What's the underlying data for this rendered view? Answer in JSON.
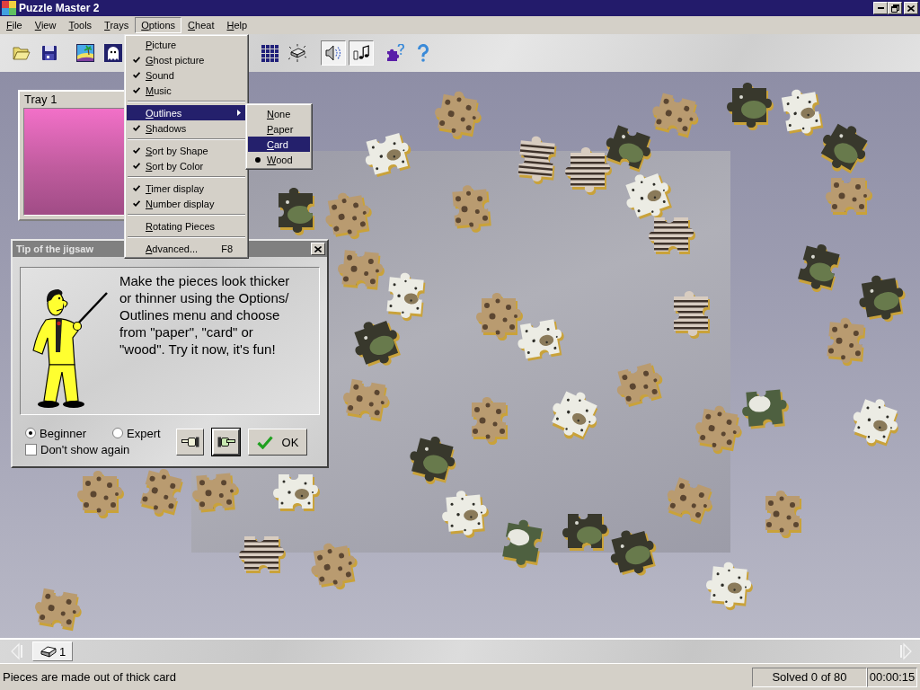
{
  "window": {
    "title": "Puzzle Master 2"
  },
  "menu_bar": [
    {
      "label": "File",
      "selected": false
    },
    {
      "label": "View",
      "selected": false
    },
    {
      "label": "Tools",
      "selected": false
    },
    {
      "label": "Trays",
      "selected": false
    },
    {
      "label": "Options",
      "selected": true
    },
    {
      "label": "Cheat",
      "selected": false
    },
    {
      "label": "Help",
      "selected": false
    }
  ],
  "toolbar": [
    {
      "buttons": [
        {
          "kind": "open",
          "pressed": false
        },
        {
          "kind": "save",
          "pressed": false
        }
      ]
    },
    {
      "buttons": [
        {
          "kind": "picture",
          "pressed": false
        },
        {
          "kind": "ghost",
          "pressed": false
        }
      ]
    },
    {
      "buttons": [
        {
          "kind": "grid",
          "pressed": false
        },
        {
          "kind": "card",
          "pressed": false
        }
      ]
    },
    {
      "buttons": [
        {
          "kind": "sound",
          "pressed": true
        },
        {
          "kind": "music",
          "pressed": true
        }
      ]
    },
    {
      "buttons": [
        {
          "kind": "piece-help",
          "pressed": false
        },
        {
          "kind": "help",
          "pressed": false
        }
      ]
    }
  ],
  "tray": {
    "title": "Tray 1"
  },
  "options_menu": {
    "groups": [
      [
        {
          "label": "Picture",
          "checked": false,
          "selected": false,
          "submenu": false
        },
        {
          "label": "Ghost picture",
          "checked": true,
          "selected": false,
          "submenu": false
        },
        {
          "label": "Sound",
          "checked": true,
          "selected": false,
          "submenu": false
        },
        {
          "label": "Music",
          "checked": true,
          "selected": false,
          "submenu": false
        }
      ],
      [
        {
          "label": "Outlines",
          "checked": false,
          "selected": true,
          "submenu": true
        },
        {
          "label": "Shadows",
          "checked": true,
          "selected": false,
          "submenu": false
        }
      ],
      [
        {
          "label": "Sort by Shape",
          "checked": true,
          "selected": false,
          "submenu": false
        },
        {
          "label": "Sort by Color",
          "checked": true,
          "selected": false,
          "submenu": false
        }
      ],
      [
        {
          "label": "Timer display",
          "checked": true,
          "selected": false,
          "submenu": false
        },
        {
          "label": "Number display",
          "checked": true,
          "selected": false,
          "submenu": false
        }
      ],
      [
        {
          "label": "Rotating Pieces",
          "checked": false,
          "selected": false,
          "submenu": false
        }
      ],
      [
        {
          "label": "Advanced...",
          "shortcut": "F8",
          "checked": false,
          "selected": false,
          "submenu": false
        }
      ]
    ]
  },
  "outlines_submenu": [
    {
      "label": "None",
      "checked": false,
      "selected": false
    },
    {
      "label": "Paper",
      "checked": false,
      "selected": false
    },
    {
      "label": "Card",
      "checked": false,
      "selected": true
    },
    {
      "label": "Wood",
      "checked": true,
      "selected": false
    }
  ],
  "tip_dialog": {
    "title": "Tip of the jigsaw",
    "text_lines": [
      "Make the pieces look thicker",
      "or thinner using the Options/",
      "Outlines menu and choose",
      "from \"paper\", \"card\" or",
      "\"wood\". Try it now, it's fun!"
    ],
    "levels": [
      {
        "label": "Beginner",
        "selected": true
      },
      {
        "label": "Expert",
        "selected": false
      }
    ],
    "dont_show": {
      "label": "Don't show again",
      "checked": false
    },
    "buttons": [
      {
        "kind": "back",
        "default": false
      },
      {
        "kind": "next",
        "default": true
      },
      {
        "kind": "ok",
        "label": "OK",
        "default": false
      }
    ]
  },
  "tray_tabs": [
    {
      "label": "1",
      "selected": true
    }
  ],
  "status_bar": {
    "message": "Pieces are made out of thick card",
    "solved": "Solved 0 of 80",
    "time": "00:00:15"
  }
}
